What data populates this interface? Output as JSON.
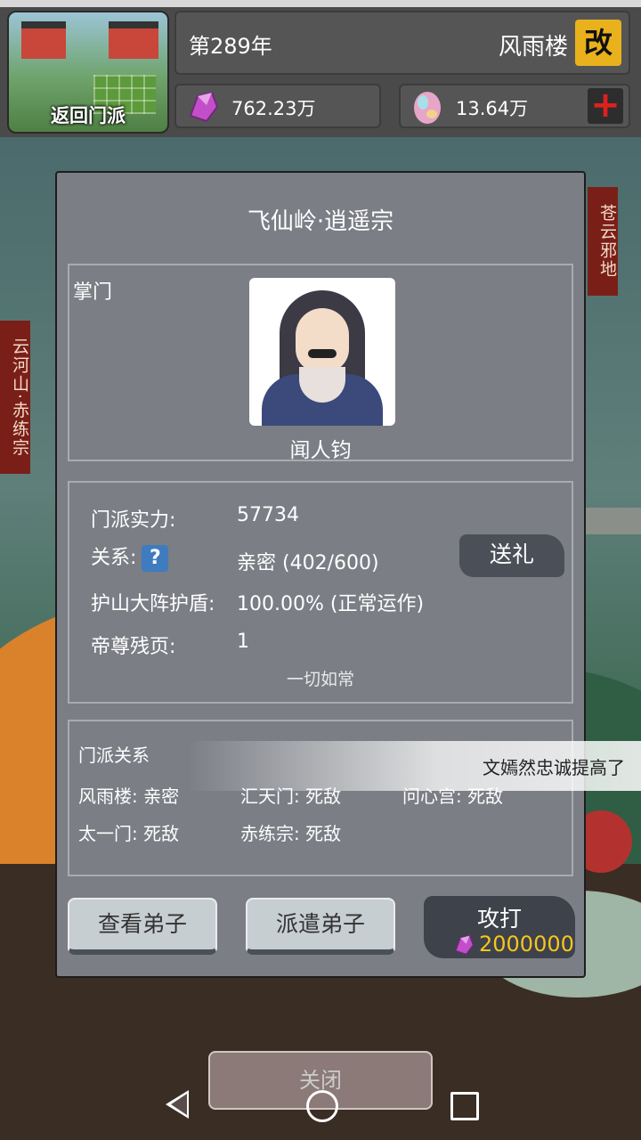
{
  "hud": {
    "return_label": "返回门派",
    "year": "第289年",
    "sect_name": "风雨楼",
    "rename_icon_char": "改",
    "spirit_stone": "762.23万",
    "spirit_egg": "13.64万",
    "add_char": "+"
  },
  "side_labels": {
    "left": "云河山·赤练宗",
    "right": "苍云邪地"
  },
  "dialog": {
    "title": "飞仙岭·逍遥宗",
    "leader_label": "掌门",
    "leader_name": "闻人钧",
    "power_label": "门派实力:",
    "power_value": "57734",
    "relation_label": "关系:",
    "relation_help": "?",
    "relation_value": "亲密  (402/600)",
    "gift_button": "送礼",
    "shield_label": "护山大阵护盾:",
    "shield_value": "100.00% (正常运作)",
    "pages_label": "帝尊残页:",
    "pages_value": "1",
    "status": "一切如常",
    "relations_title": "门派关系",
    "relations": [
      "风雨楼: 亲密",
      "汇天门: 死敌",
      "问心宫: 死敌",
      "太一门: 死敌",
      "赤练宗: 死敌"
    ],
    "view_disciples": "查看弟子",
    "dispatch_disciples": "派遣弟子",
    "attack_label": "攻打",
    "attack_cost": "2000000",
    "close_button": "关闭"
  },
  "toast": "文嫣然忠诚提高了",
  "colors": {
    "accent_yellow": "#f7c51f",
    "dialog_bg": "#7b7e85",
    "add_red": "#e0201c"
  }
}
